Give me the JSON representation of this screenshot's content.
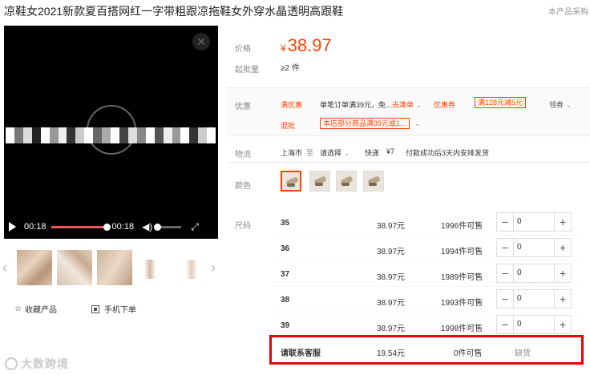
{
  "product": {
    "title": "凉鞋女2021新款夏百搭网红一字带粗跟凉拖鞋女外穿水晶透明高跟鞋",
    "header_right": "本产品采购"
  },
  "video": {
    "time_current": "00:18",
    "time_total": "00:18",
    "progress": 1.0,
    "close_icon": "close-icon",
    "play_icon": "play-icon",
    "volume_icon": "volume-icon",
    "fullscreen_icon": "fullscreen-icon"
  },
  "thumbnails": {
    "prev_icon": "chevron-left-icon",
    "next_icon": "chevron-right-icon"
  },
  "actions": {
    "favorite_label": "收藏产品",
    "mobile_order_label": "手机下单"
  },
  "watermark": "大数跨境",
  "pricing": {
    "price_label": "价格",
    "currency": "¥",
    "price": "38.97",
    "moq_label": "起批量",
    "moq_value": "≥2 件"
  },
  "promotions": {
    "label": "优惠",
    "row1_tag": "满优惠",
    "row1_text": "单笔订单满39元，免...",
    "row1_link": "去凑单",
    "coupon_tag": "优惠券",
    "coupon_box": "满128元减5元",
    "coupon_link": "领券",
    "row2_tag": "混批",
    "row2_box": "本店部分商品满39元或1..."
  },
  "logistics": {
    "label": "物流",
    "origin": "上海市",
    "to": "至",
    "dest": "请选择",
    "method": "快递",
    "fee": "¥7",
    "note": "付款成功后3天内安排发货"
  },
  "color": {
    "label": "颜色"
  },
  "sizes": {
    "label": "尺码",
    "rows": [
      {
        "size": "35",
        "price": "38.97元",
        "stock": "1996件可售",
        "qty": "0"
      },
      {
        "size": "36",
        "price": "38.97元",
        "stock": "1994件可售",
        "qty": "0"
      },
      {
        "size": "37",
        "price": "38.97元",
        "stock": "1989件可售",
        "qty": "0"
      },
      {
        "size": "38",
        "price": "38.97元",
        "stock": "1993件可售",
        "qty": "0"
      },
      {
        "size": "39",
        "price": "38.97元",
        "stock": "1998件可售",
        "qty": "0"
      }
    ],
    "contact": {
      "label": "请联系客服",
      "price": "19.54元",
      "stock": "0件可售",
      "status": "缺货"
    }
  }
}
